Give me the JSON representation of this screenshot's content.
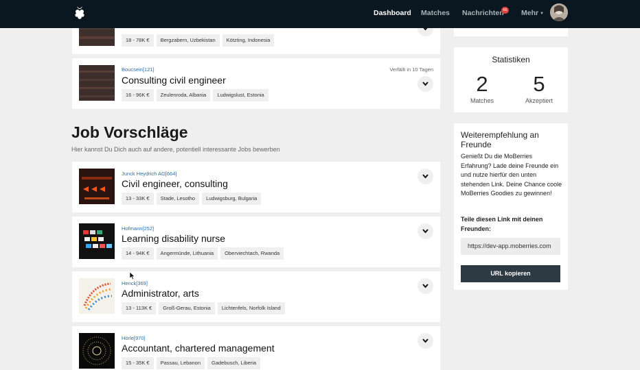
{
  "nav": {
    "logo_icon": "raspberry-logo",
    "links": [
      "Dashboard",
      "Matches",
      "Nachrichten",
      "Mehr"
    ],
    "messages_badge": "66",
    "active": "Dashboard"
  },
  "matches": [
    {
      "company": "",
      "title": "",
      "expiry": "",
      "tags": [
        "18 - 78K €",
        "Bergzabern, Uzbekistan",
        "Kötzting, Indonesia"
      ]
    },
    {
      "company": "Boucsein[121]",
      "title": "Consulting civil engineer",
      "expiry": "Verfällt in 10 Tagen",
      "tags": [
        "16 - 96K €",
        "Zeulenroda, Albania",
        "Ludwigslust, Estonia"
      ]
    }
  ],
  "suggestions_section": {
    "title": "Job Vorschläge",
    "subtitle": "Hier kannst Du Dich auch auf andere, potentiell interessante Jobs bewerben"
  },
  "suggestions": [
    {
      "company": "Junck Heydrich AG[664]",
      "title": "Civil engineer, consulting",
      "tags": [
        "13 - 33K €",
        "Stade, Lesotho",
        "Ludwigsburg, Bulgaria"
      ]
    },
    {
      "company": "Hofmann[252]",
      "title": "Learning disability nurse",
      "tags": [
        "14 - 94K €",
        "Angermünde, Lithuania",
        "Oberviechtach, Rwanda"
      ]
    },
    {
      "company": "Henck[369]",
      "title": "Administrator, arts",
      "tags": [
        "13 - 113K €",
        "Groß-Gerau, Estonia",
        "Lichtenfels, Norfolk Island"
      ]
    },
    {
      "company": "Hörle[970]",
      "title": "Accountant, chartered management",
      "tags": [
        "15 - 35K €",
        "Passau, Lebanon",
        "Gadebusch, Liberia"
      ]
    }
  ],
  "stats": {
    "title": "Statistiken",
    "matches_value": "2",
    "matches_label": "Matches",
    "accepted_value": "5",
    "accepted_label": "Akzeptiert"
  },
  "referral": {
    "title": "Weiterempfehlung an Freunde",
    "body": "Genießt Du die MoBerries Erfahrung? Lade deine Freunde ein und nutze hierfür den unten stehenden Link. Deine Chance coole MoBerries Goodies zu gewinnen!",
    "share_label": "Teile diesen Link mit deinen Freunden:",
    "link_value": "https://dev-app.moberries.com",
    "copy_button": "URL kopieren"
  },
  "colors": {
    "navbar": "#0b1720",
    "accent_link": "#2c6faa",
    "button_dark": "#2d3a44",
    "badge": "#e0403b",
    "page_bg": "#efefef"
  }
}
